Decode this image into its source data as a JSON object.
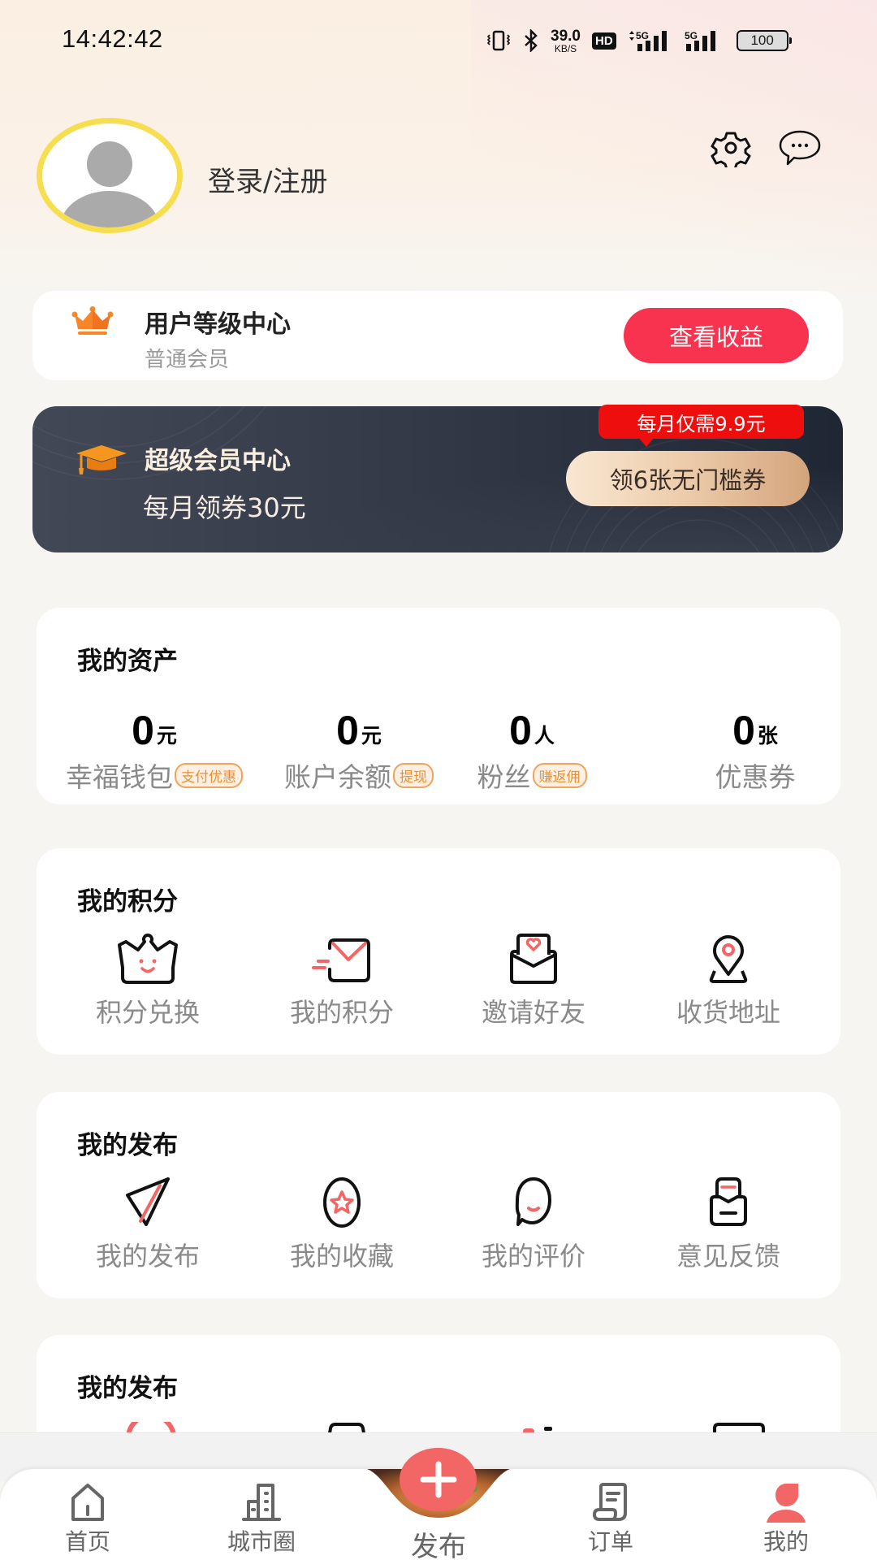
{
  "status_bar": {
    "time": "14:42:42",
    "net_speed_value": "39.0",
    "net_speed_unit": "KB/S",
    "hd_label": "HD",
    "signal1_label": "5G",
    "signal2_label": "5G",
    "battery": "100",
    "icons": [
      "vibrate-icon",
      "bluetooth-icon",
      "hd-voice-icon",
      "signal-5g-icon",
      "signal-5g-icon",
      "battery-icon"
    ]
  },
  "header": {
    "login_label": "登录/注册",
    "icons": [
      "settings-gear-icon",
      "message-bubble-icon"
    ]
  },
  "level_card": {
    "title": "用户等级中心",
    "subtitle": "普通会员",
    "button_label": "查看收益",
    "icon": "crown-icon"
  },
  "vip_card": {
    "title": "超级会员中心",
    "subtitle": "每月领券30元",
    "badge": "每月仅需9.9元",
    "button_label": "领6张无门槛券",
    "icon": "graduation-cap-icon"
  },
  "assets": {
    "title": "我的资产",
    "items": [
      {
        "value": "0",
        "unit": "元",
        "label": "幸福钱包",
        "tag": "支付优惠"
      },
      {
        "value": "0",
        "unit": "元",
        "label": "账户余额",
        "tag": "提现"
      },
      {
        "value": "0",
        "unit": "人",
        "label": "粉丝",
        "tag": "赚返佣"
      },
      {
        "value": "0",
        "unit": "张",
        "label": "优惠券",
        "tag": ""
      }
    ]
  },
  "points": {
    "title": "我的积分",
    "items": [
      {
        "label": "积分兑换",
        "icon": "crown-smile-icon"
      },
      {
        "label": "我的积分",
        "icon": "mail-icon"
      },
      {
        "label": "邀请好友",
        "icon": "invite-letter-icon"
      },
      {
        "label": "收货地址",
        "icon": "location-pin-icon"
      }
    ]
  },
  "publish": {
    "title": "我的发布",
    "items": [
      {
        "label": "我的发布",
        "icon": "paper-plane-icon"
      },
      {
        "label": "我的收藏",
        "icon": "star-circle-icon"
      },
      {
        "label": "我的评价",
        "icon": "comment-smile-icon"
      },
      {
        "label": "意见反馈",
        "icon": "feedback-box-icon"
      }
    ]
  },
  "publish2": {
    "title": "我的发布"
  },
  "bottom_nav": {
    "active_color": "#f26665",
    "items": [
      {
        "label": "首页",
        "icon": "home-icon",
        "active": false
      },
      {
        "label": "城市圈",
        "icon": "city-building-icon",
        "active": false
      },
      {
        "label": "发布",
        "icon": "plus-icon",
        "active": false
      },
      {
        "label": "订单",
        "icon": "order-scroll-icon",
        "active": false
      },
      {
        "label": "我的",
        "icon": "user-icon",
        "active": true
      }
    ]
  }
}
